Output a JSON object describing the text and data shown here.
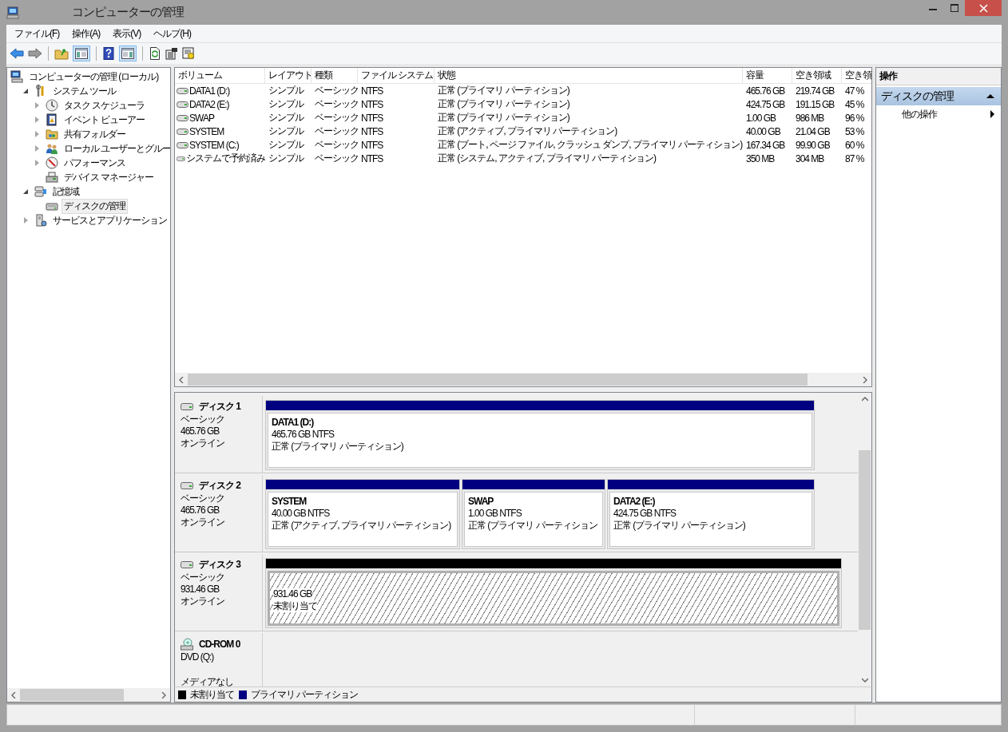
{
  "window": {
    "title": "コンピューターの管理"
  },
  "menu": [
    "ファイル(F)",
    "操作(A)",
    "表示(V)",
    "ヘルプ(H)"
  ],
  "tree": [
    {
      "label": "コンピューターの管理 (ローカル)",
      "selected": false,
      "children": [
        {
          "label": "システム ツール",
          "expanded": true,
          "selected": false,
          "children": [
            {
              "label": "タスク スケジューラ",
              "expanded": false,
              "selected": false
            },
            {
              "label": "イベント ビューアー",
              "expanded": false,
              "selected": false
            },
            {
              "label": "共有フォルダー",
              "expanded": false,
              "selected": false
            },
            {
              "label": "ローカル ユーザーとグルー",
              "expanded": false,
              "selected": false
            },
            {
              "label": "パフォーマンス",
              "expanded": false,
              "selected": false
            },
            {
              "label": "デバイス マネージャー",
              "selected": false
            }
          ]
        },
        {
          "label": "記憶域",
          "expanded": true,
          "selected": false,
          "children": [
            {
              "label": "ディスクの管理",
              "selected": true
            }
          ]
        },
        {
          "label": "サービスとアプリケーション",
          "expanded": false,
          "selected": false
        }
      ]
    }
  ],
  "volumes": {
    "columns": [
      "ボリューム",
      "レイアウト",
      "種類",
      "ファイル システム",
      "状態",
      "容量",
      "空き領域",
      "空き領"
    ],
    "rows": [
      [
        "DATA1 (D:)",
        "シンプル",
        "ベーシック",
        "NTFS",
        "正常 (プライマリ パーティション)",
        "465.76 GB",
        "219.74 GB",
        "47 %"
      ],
      [
        "DATA2 (E:)",
        "シンプル",
        "ベーシック",
        "NTFS",
        "正常 (プライマリ パーティション)",
        "424.75 GB",
        "191.15 GB",
        "45 %"
      ],
      [
        "SWAP",
        "シンプル",
        "ベーシック",
        "NTFS",
        "正常 (プライマリ パーティション)",
        "1.00 GB",
        "986 MB",
        "96 %"
      ],
      [
        "SYSTEM",
        "シンプル",
        "ベーシック",
        "NTFS",
        "正常 (アクティブ, プライマリ パーティション)",
        "40.00 GB",
        "21.04 GB",
        "53 %"
      ],
      [
        "SYSTEM (C:)",
        "シンプル",
        "ベーシック",
        "NTFS",
        "正常 (ブート, ページ ファイル, クラッシュ ダンプ, プライマリ パーティション)",
        "167.34 GB",
        "99.90 GB",
        "60 %"
      ],
      [
        "システムで予約済み",
        "シンプル",
        "ベーシック",
        "NTFS",
        "正常 (システム, アクティブ, プライマリ パーティション)",
        "350 MB",
        "304 MB",
        "87 %"
      ]
    ]
  },
  "disks": [
    {
      "kind": "disk",
      "name": "ディスク 1",
      "type": "ベーシック",
      "size": "465.76 GB",
      "status": "オンライン",
      "partitions": [
        {
          "kind": "primary",
          "name": "DATA1  (D:)",
          "size": "465.76 GB NTFS",
          "status": "正常 (プライマリ パーティション)"
        }
      ]
    },
    {
      "kind": "disk",
      "name": "ディスク 2",
      "type": "ベーシック",
      "size": "465.76 GB",
      "status": "オンライン",
      "partitions": [
        {
          "kind": "primary",
          "name": "SYSTEM",
          "size": "40.00 GB NTFS",
          "status": "正常 (アクティブ, プライマリ パーティション)"
        },
        {
          "kind": "primary",
          "name": "SWAP",
          "size": "1.00 GB NTFS",
          "status": "正常 (プライマリ パーティション"
        },
        {
          "kind": "primary",
          "name": "DATA2  (E:)",
          "size": "424.75 GB NTFS",
          "status": "正常 (プライマリ パーティション)"
        }
      ]
    },
    {
      "kind": "disk",
      "name": "ディスク 3",
      "type": "ベーシック",
      "size": "931.46 GB",
      "status": "オンライン",
      "partitions": [
        {
          "kind": "unallocated",
          "size": "931.46 GB",
          "status": "未割り当て"
        }
      ]
    },
    {
      "kind": "cdrom",
      "name": "CD-ROM 0",
      "type": "DVD (Q:)",
      "status": "メディアなし"
    }
  ],
  "legend": [
    {
      "label": "未割り当て",
      "color": "#000000"
    },
    {
      "label": "プライマリ パーティション",
      "color": "#000080"
    }
  ],
  "actions": {
    "title": "操作",
    "section": {
      "label": "ディスクの管理",
      "expanded": true
    },
    "items": [
      "他の操作"
    ]
  }
}
